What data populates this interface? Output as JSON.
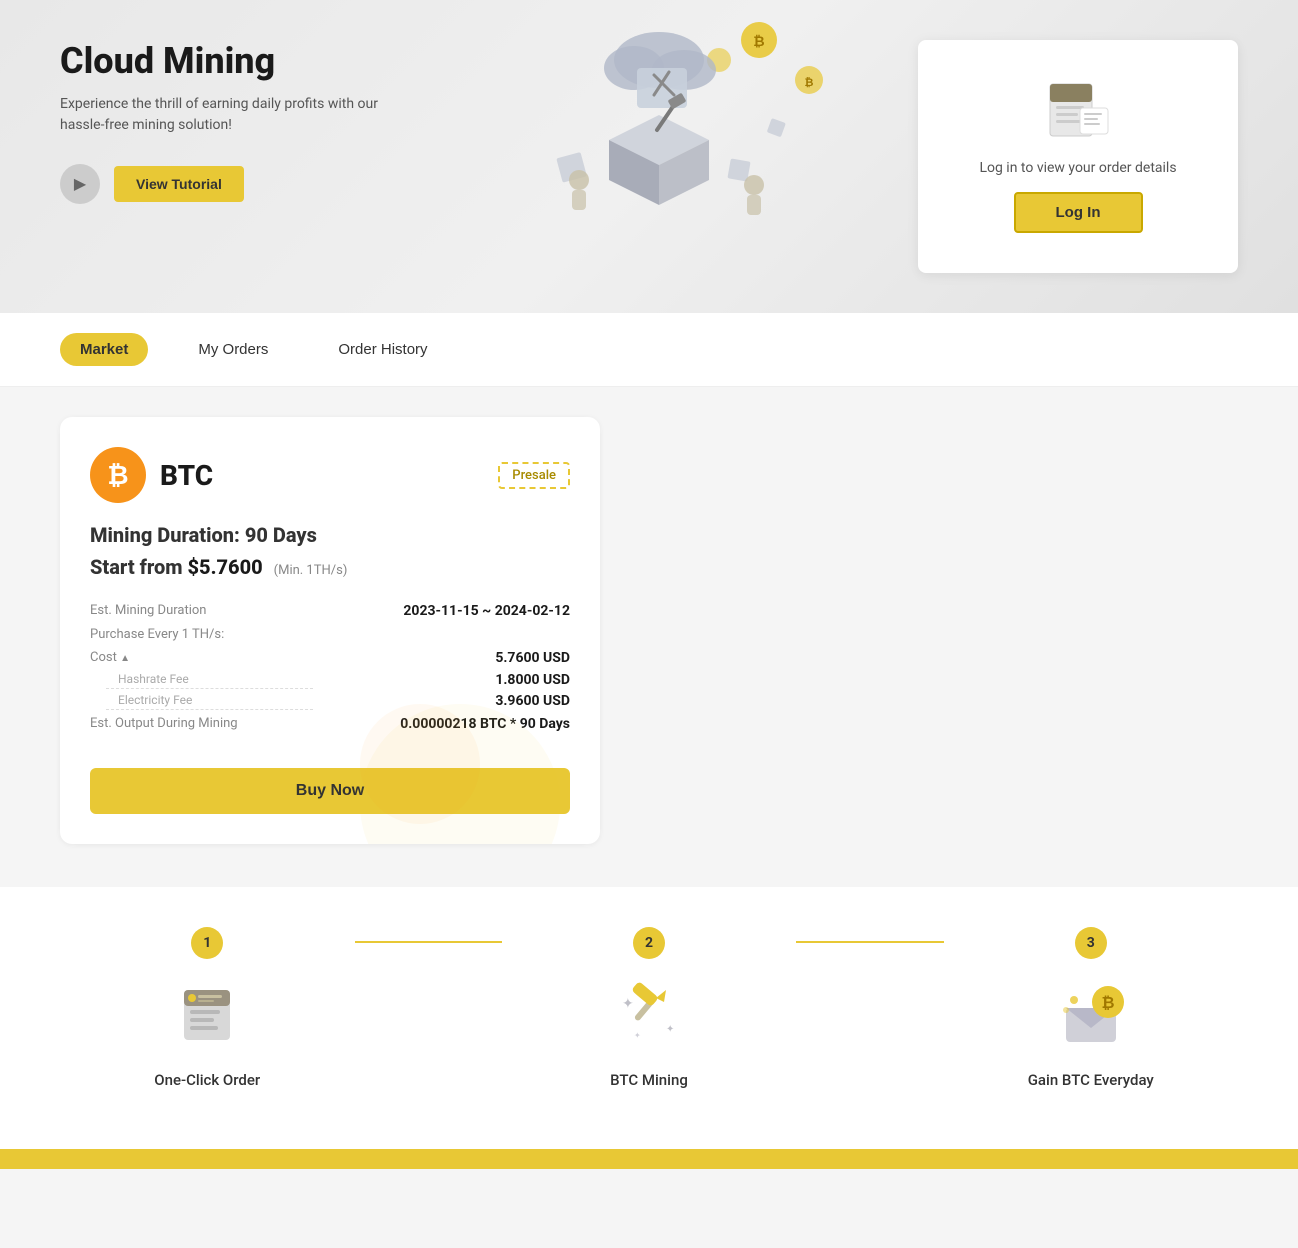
{
  "hero": {
    "title": "Cloud Mining",
    "subtitle": "Experience the thrill of earning daily profits with our hassle-free mining solution!",
    "play_label": "▶",
    "tutorial_btn": "View Tutorial",
    "login_card": {
      "text": "Log in to view your order details",
      "btn": "Log In"
    }
  },
  "tabs": {
    "items": [
      {
        "label": "Market",
        "active": true
      },
      {
        "label": "My Orders",
        "active": false
      },
      {
        "label": "Order History",
        "active": false
      }
    ]
  },
  "mining_card": {
    "coin": "BTC",
    "badge": "Presale",
    "duration_label": "Mining Duration: 90 Days",
    "start_from_label": "Start from",
    "start_from_price": "$5.7600",
    "min_label": "(Min. 1TH/s)",
    "est_duration_label": "Est. Mining Duration",
    "est_duration_val": "2023-11-15 ~ 2024-02-12",
    "purchase_label": "Purchase Every 1 TH/s:",
    "cost_label": "Cost",
    "cost_val": "5.7600 USD",
    "hashrate_fee_label": "Hashrate Fee",
    "hashrate_fee_val": "1.8000 USD",
    "electricity_fee_label": "Electricity Fee",
    "electricity_fee_val": "3.9600 USD",
    "est_output_label": "Est. Output During Mining",
    "est_output_val": "0.00000218 BTC * 90 Days",
    "buy_btn": "Buy Now"
  },
  "steps": [
    {
      "number": "1",
      "icon": "📋",
      "label": "One-Click Order"
    },
    {
      "number": "2",
      "icon": "⛏️",
      "label": "BTC Mining"
    },
    {
      "number": "3",
      "icon": "₿",
      "label": "Gain BTC Everyday"
    }
  ]
}
